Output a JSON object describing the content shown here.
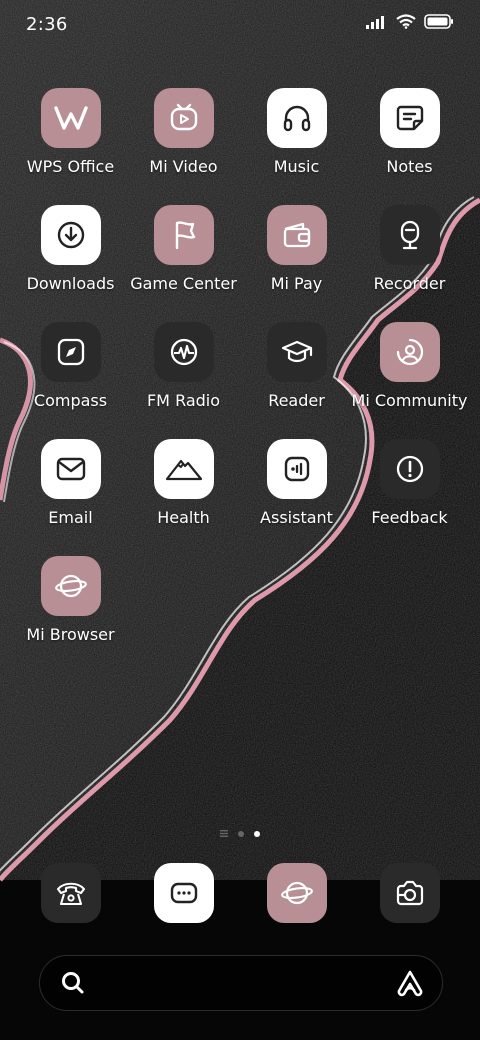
{
  "status_bar": {
    "time": "2:36"
  },
  "apps": [
    {
      "name": "wps-office",
      "label": "WPS Office",
      "icon": "wps-icon",
      "style": "pink"
    },
    {
      "name": "mi-video",
      "label": "Mi Video",
      "icon": "video-icon",
      "style": "pink"
    },
    {
      "name": "music",
      "label": "Music",
      "icon": "headphones-icon",
      "style": "white"
    },
    {
      "name": "notes",
      "label": "Notes",
      "icon": "notes-icon",
      "style": "white"
    },
    {
      "name": "downloads",
      "label": "Downloads",
      "icon": "download-icon",
      "style": "white"
    },
    {
      "name": "game-center",
      "label": "Game Center",
      "icon": "flag-icon",
      "style": "pink"
    },
    {
      "name": "mi-pay",
      "label": "Mi Pay",
      "icon": "wallet-icon",
      "style": "pink"
    },
    {
      "name": "recorder",
      "label": "Recorder",
      "icon": "microphone-icon",
      "style": "dark"
    },
    {
      "name": "compass",
      "label": "Compass",
      "icon": "compass-icon",
      "style": "dark"
    },
    {
      "name": "fm-radio",
      "label": "FM Radio",
      "icon": "radio-icon",
      "style": "dark"
    },
    {
      "name": "reader",
      "label": "Reader",
      "icon": "graduation-cap-icon",
      "style": "dark"
    },
    {
      "name": "mi-community",
      "label": "Mi Community",
      "icon": "community-icon",
      "style": "pink"
    },
    {
      "name": "email",
      "label": "Email",
      "icon": "envelope-icon",
      "style": "white"
    },
    {
      "name": "health",
      "label": "Health",
      "icon": "mountain-icon",
      "style": "white"
    },
    {
      "name": "assistant",
      "label": "Assistant",
      "icon": "assistant-icon",
      "style": "white"
    },
    {
      "name": "feedback",
      "label": "Feedback",
      "icon": "exclamation-icon",
      "style": "dark"
    },
    {
      "name": "mi-browser",
      "label": "Mi Browser",
      "icon": "planet-icon",
      "style": "pink"
    }
  ],
  "dock": [
    {
      "name": "phone",
      "icon": "phone-icon",
      "style": "dark"
    },
    {
      "name": "messaging",
      "icon": "message-icon",
      "style": "white"
    },
    {
      "name": "browser",
      "icon": "planet-icon",
      "style": "pink"
    },
    {
      "name": "camera",
      "icon": "camera-icon",
      "style": "dark"
    }
  ],
  "page_indicator": {
    "total_dots": 2,
    "active_index": 1
  },
  "search_bar": {
    "left_icon": "search-icon",
    "right_icon": "assistant-logo-icon"
  },
  "colors": {
    "pink_tile": "#b78f95",
    "white_tile": "#ffffff",
    "dark_tile": "#2a2a2a",
    "wave_edge": "#f2a6b8"
  }
}
